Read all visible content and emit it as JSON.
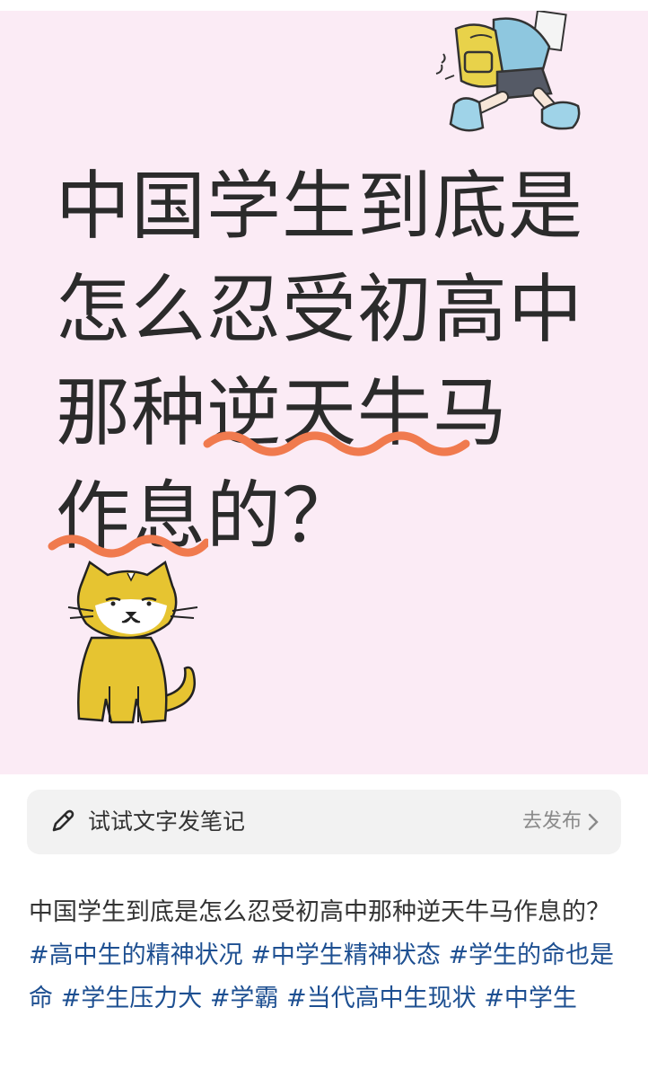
{
  "cover": {
    "headline_lines": [
      "中国学生到底是",
      "怎么忍受初高中",
      "那种逆天牛马",
      "作息的？"
    ]
  },
  "compose_prompt": {
    "icon": "pencil-icon",
    "text": "试试文字发笔记",
    "action_label": "去发布",
    "action_icon": "chevron-right-icon"
  },
  "post": {
    "text": "中国学生到底是怎么忍受初高中那种逆天牛马作息的？",
    "tags": [
      "#高中生的精神状况",
      "#中学生精神状态",
      "#学生的命也是命",
      "#学生压力大",
      "#学霸",
      "#当代高中生现状",
      "#中学生"
    ]
  },
  "colors": {
    "cover_bg": "#fbebf5",
    "underline": "#f07a4e",
    "tag": "#1d4f91",
    "cat": "#e6c431"
  }
}
